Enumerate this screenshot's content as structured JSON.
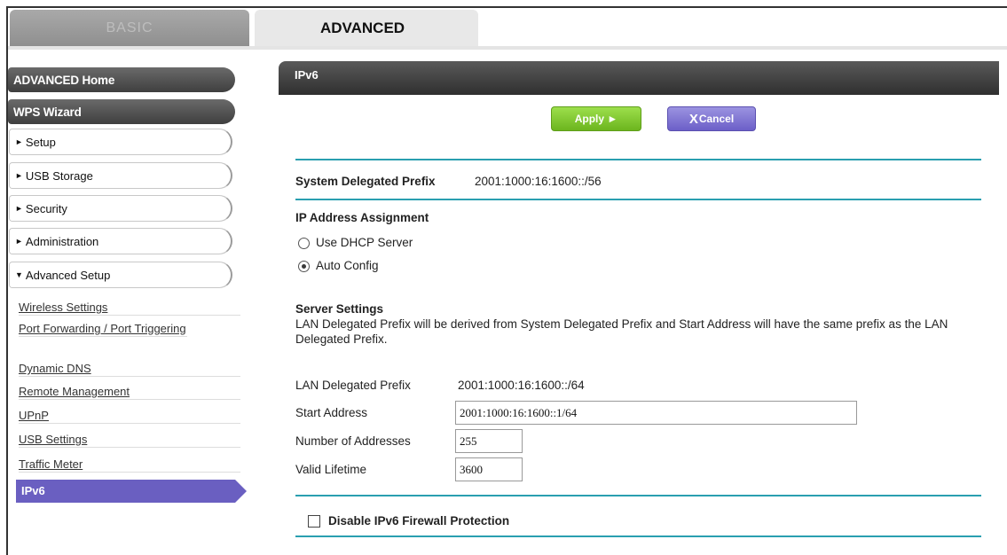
{
  "tabs": {
    "basic": "BASIC",
    "advanced": "ADVANCED"
  },
  "sidebar": {
    "advanced_home": "ADVANCED Home",
    "wps_wizard": "WPS Wizard",
    "menu": [
      "Setup",
      "USB Storage",
      "Security",
      "Administration",
      "Advanced Setup"
    ],
    "advanced_setup_links": [
      "Wireless Settings",
      "Port Forwarding / Port Triggering",
      "Dynamic DNS",
      "Remote Management",
      "UPnP",
      "USB Settings",
      "Traffic Meter"
    ],
    "active_link": "IPv6"
  },
  "header": {
    "title": "IPv6"
  },
  "buttons": {
    "apply": "Apply ►",
    "cancel_icon": "X",
    "cancel": "Cancel"
  },
  "prefix": {
    "label": "System Delegated Prefix",
    "value": "2001:1000:16:1600::/56"
  },
  "ip_assignment": {
    "title": "IP Address Assignment",
    "option_dhcp": "Use DHCP Server",
    "option_auto": "Auto Config",
    "selected": "Auto Config"
  },
  "server_settings": {
    "title": "Server Settings",
    "description": "LAN Delegated Prefix will be derived from System Delegated Prefix and Start Address will have the same prefix as the LAN Delegated Prefix.",
    "lan_prefix_label": "LAN Delegated Prefix",
    "lan_prefix_value": "2001:1000:16:1600::/64",
    "start_address_label": "Start Address",
    "start_address_value": "2001:1000:16:1600::1/64",
    "num_addresses_label": "Number of Addresses",
    "num_addresses_value": "255",
    "valid_lifetime_label": "Valid Lifetime",
    "valid_lifetime_value": "3600"
  },
  "firewall": {
    "label": "Disable IPv6 Firewall Protection",
    "checked": false
  },
  "colors": {
    "accent_rule": "#2a9fb0",
    "apply_green": "#7cc42a",
    "cancel_purple": "#6c5fc8",
    "active_purple": "#6a5fc1"
  }
}
